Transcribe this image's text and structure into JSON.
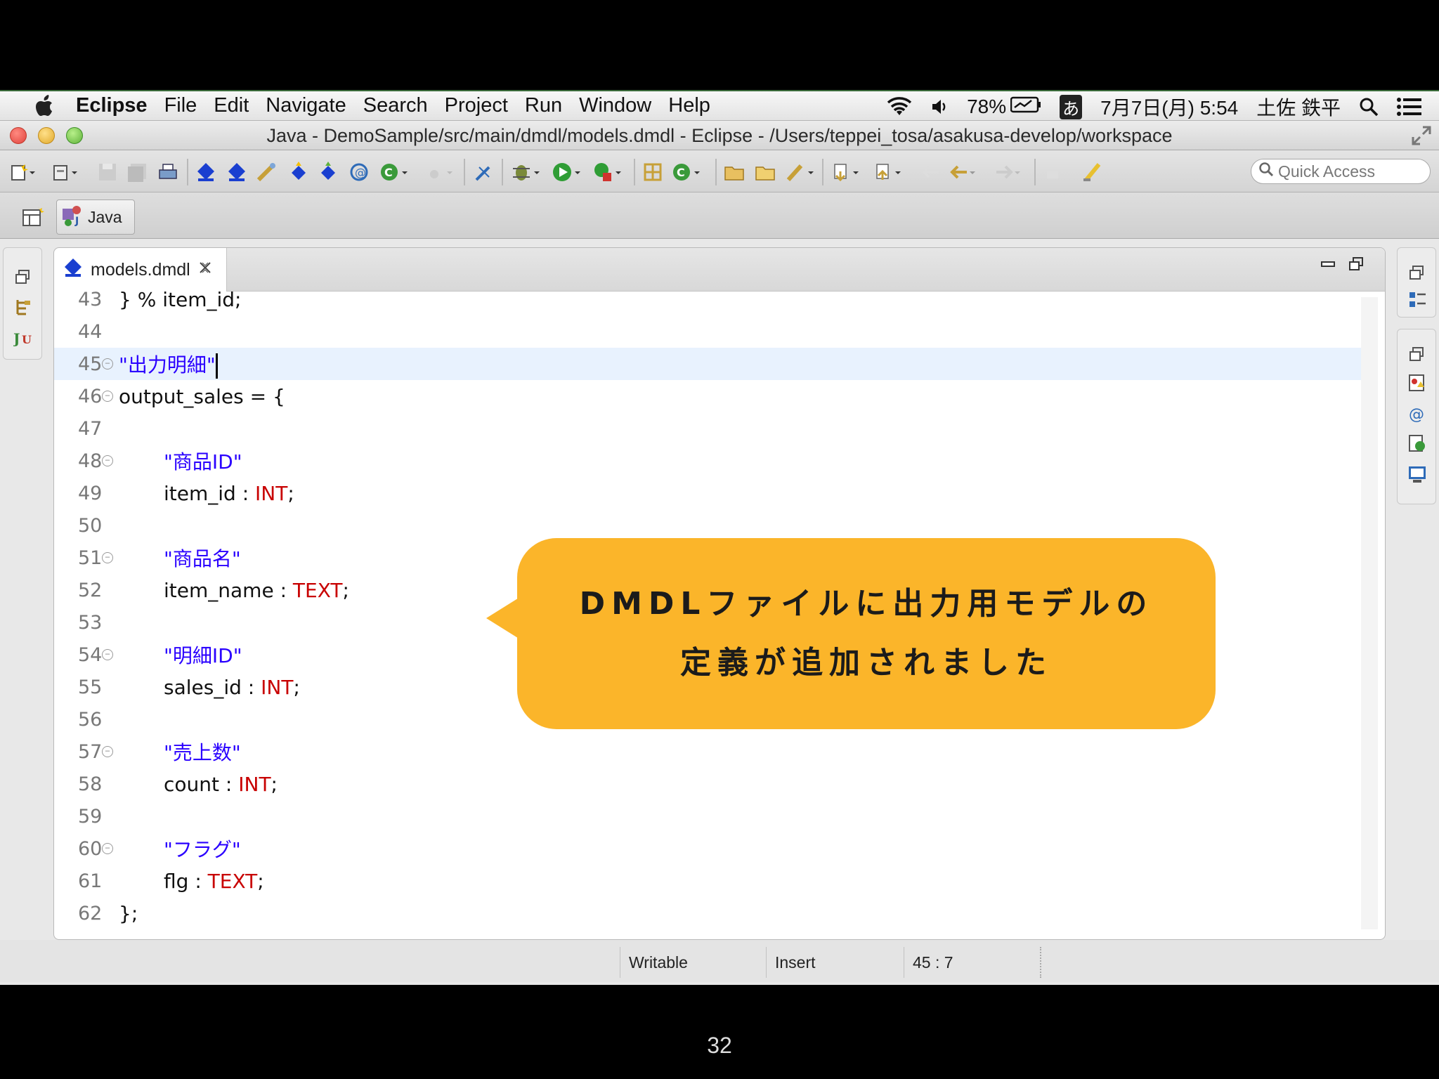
{
  "menubar": {
    "app_name": "Eclipse",
    "menus": [
      "File",
      "Edit",
      "Navigate",
      "Search",
      "Project",
      "Run",
      "Window",
      "Help"
    ],
    "battery": "78%",
    "input_mode": "あ",
    "datetime": "7月7日(月) 5:54",
    "user": "土佐 鉄平"
  },
  "window": {
    "title": "Java - DemoSample/src/main/dmdl/models.dmdl - Eclipse - /Users/teppei_tosa/asakusa-develop/workspace"
  },
  "toolbar": {
    "quick_access_placeholder": "Quick Access"
  },
  "perspective": {
    "active_label": "Java"
  },
  "editor": {
    "tab_label": "models.dmdl",
    "lines": [
      {
        "no": "43",
        "text": "} % item_id;",
        "kind": "partial"
      },
      {
        "no": "44",
        "text": ""
      },
      {
        "no": "45",
        "text": "\"出力明細\"",
        "kind": "string",
        "fold": true,
        "current": true
      },
      {
        "no": "46",
        "text": "output_sales = {",
        "fold": true
      },
      {
        "no": "47",
        "text": ""
      },
      {
        "no": "48",
        "text": "\"商品ID\"",
        "kind": "string",
        "fold": true,
        "indent": true
      },
      {
        "no": "49",
        "name": "item_id",
        "sep": " : ",
        "type": "INT",
        "end": ";",
        "indent": true
      },
      {
        "no": "50",
        "text": ""
      },
      {
        "no": "51",
        "text": "\"商品名\"",
        "kind": "string",
        "fold": true,
        "indent": true
      },
      {
        "no": "52",
        "name": "item_name",
        "sep": " : ",
        "type": "TEXT",
        "end": ";",
        "indent": true
      },
      {
        "no": "53",
        "text": ""
      },
      {
        "no": "54",
        "text": "\"明細ID\"",
        "kind": "string",
        "fold": true,
        "indent": true
      },
      {
        "no": "55",
        "name": "sales_id",
        "sep": " : ",
        "type": "INT",
        "end": ";",
        "indent": true
      },
      {
        "no": "56",
        "text": ""
      },
      {
        "no": "57",
        "text": "\"売上数\"",
        "kind": "string",
        "fold": true,
        "indent": true
      },
      {
        "no": "58",
        "name": "count",
        "sep": " : ",
        "type": "INT",
        "end": ";",
        "indent": true
      },
      {
        "no": "59",
        "text": ""
      },
      {
        "no": "60",
        "text": "\"フラグ\"",
        "kind": "string",
        "fold": true,
        "indent": true
      },
      {
        "no": "61",
        "name": "flg",
        "sep": " : ",
        "type": "TEXT",
        "end": ";",
        "indent": true
      },
      {
        "no": "62",
        "text": "};"
      }
    ]
  },
  "statusbar": {
    "writable": "Writable",
    "insert_mode": "Insert",
    "position": "45 : 7"
  },
  "callout": {
    "line1": "DMDLファイルに出力用モデルの",
    "line2": "定義が追加されました"
  },
  "slide_number": "32",
  "colors": {
    "callout": "#fbb52a",
    "string": "#2a00ff",
    "type": "#c80000",
    "current_line": "#e8f2fe"
  }
}
